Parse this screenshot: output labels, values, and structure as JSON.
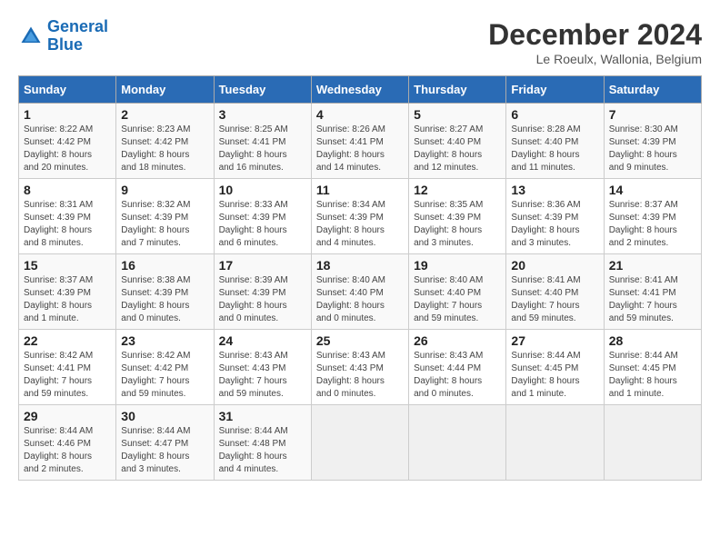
{
  "header": {
    "logo_line1": "General",
    "logo_line2": "Blue",
    "month_title": "December 2024",
    "subtitle": "Le Roeulx, Wallonia, Belgium"
  },
  "columns": [
    "Sunday",
    "Monday",
    "Tuesday",
    "Wednesday",
    "Thursday",
    "Friday",
    "Saturday"
  ],
  "weeks": [
    [
      {
        "day": "1",
        "detail": "Sunrise: 8:22 AM\nSunset: 4:42 PM\nDaylight: 8 hours\nand 20 minutes."
      },
      {
        "day": "2",
        "detail": "Sunrise: 8:23 AM\nSunset: 4:42 PM\nDaylight: 8 hours\nand 18 minutes."
      },
      {
        "day": "3",
        "detail": "Sunrise: 8:25 AM\nSunset: 4:41 PM\nDaylight: 8 hours\nand 16 minutes."
      },
      {
        "day": "4",
        "detail": "Sunrise: 8:26 AM\nSunset: 4:41 PM\nDaylight: 8 hours\nand 14 minutes."
      },
      {
        "day": "5",
        "detail": "Sunrise: 8:27 AM\nSunset: 4:40 PM\nDaylight: 8 hours\nand 12 minutes."
      },
      {
        "day": "6",
        "detail": "Sunrise: 8:28 AM\nSunset: 4:40 PM\nDaylight: 8 hours\nand 11 minutes."
      },
      {
        "day": "7",
        "detail": "Sunrise: 8:30 AM\nSunset: 4:39 PM\nDaylight: 8 hours\nand 9 minutes."
      }
    ],
    [
      {
        "day": "8",
        "detail": "Sunrise: 8:31 AM\nSunset: 4:39 PM\nDaylight: 8 hours\nand 8 minutes."
      },
      {
        "day": "9",
        "detail": "Sunrise: 8:32 AM\nSunset: 4:39 PM\nDaylight: 8 hours\nand 7 minutes."
      },
      {
        "day": "10",
        "detail": "Sunrise: 8:33 AM\nSunset: 4:39 PM\nDaylight: 8 hours\nand 6 minutes."
      },
      {
        "day": "11",
        "detail": "Sunrise: 8:34 AM\nSunset: 4:39 PM\nDaylight: 8 hours\nand 4 minutes."
      },
      {
        "day": "12",
        "detail": "Sunrise: 8:35 AM\nSunset: 4:39 PM\nDaylight: 8 hours\nand 3 minutes."
      },
      {
        "day": "13",
        "detail": "Sunrise: 8:36 AM\nSunset: 4:39 PM\nDaylight: 8 hours\nand 3 minutes."
      },
      {
        "day": "14",
        "detail": "Sunrise: 8:37 AM\nSunset: 4:39 PM\nDaylight: 8 hours\nand 2 minutes."
      }
    ],
    [
      {
        "day": "15",
        "detail": "Sunrise: 8:37 AM\nSunset: 4:39 PM\nDaylight: 8 hours\nand 1 minute."
      },
      {
        "day": "16",
        "detail": "Sunrise: 8:38 AM\nSunset: 4:39 PM\nDaylight: 8 hours\nand 0 minutes."
      },
      {
        "day": "17",
        "detail": "Sunrise: 8:39 AM\nSunset: 4:39 PM\nDaylight: 8 hours\nand 0 minutes."
      },
      {
        "day": "18",
        "detail": "Sunrise: 8:40 AM\nSunset: 4:40 PM\nDaylight: 8 hours\nand 0 minutes."
      },
      {
        "day": "19",
        "detail": "Sunrise: 8:40 AM\nSunset: 4:40 PM\nDaylight: 7 hours\nand 59 minutes."
      },
      {
        "day": "20",
        "detail": "Sunrise: 8:41 AM\nSunset: 4:40 PM\nDaylight: 7 hours\nand 59 minutes."
      },
      {
        "day": "21",
        "detail": "Sunrise: 8:41 AM\nSunset: 4:41 PM\nDaylight: 7 hours\nand 59 minutes."
      }
    ],
    [
      {
        "day": "22",
        "detail": "Sunrise: 8:42 AM\nSunset: 4:41 PM\nDaylight: 7 hours\nand 59 minutes."
      },
      {
        "day": "23",
        "detail": "Sunrise: 8:42 AM\nSunset: 4:42 PM\nDaylight: 7 hours\nand 59 minutes."
      },
      {
        "day": "24",
        "detail": "Sunrise: 8:43 AM\nSunset: 4:43 PM\nDaylight: 7 hours\nand 59 minutes."
      },
      {
        "day": "25",
        "detail": "Sunrise: 8:43 AM\nSunset: 4:43 PM\nDaylight: 8 hours\nand 0 minutes."
      },
      {
        "day": "26",
        "detail": "Sunrise: 8:43 AM\nSunset: 4:44 PM\nDaylight: 8 hours\nand 0 minutes."
      },
      {
        "day": "27",
        "detail": "Sunrise: 8:44 AM\nSunset: 4:45 PM\nDaylight: 8 hours\nand 1 minute."
      },
      {
        "day": "28",
        "detail": "Sunrise: 8:44 AM\nSunset: 4:45 PM\nDaylight: 8 hours\nand 1 minute."
      }
    ],
    [
      {
        "day": "29",
        "detail": "Sunrise: 8:44 AM\nSunset: 4:46 PM\nDaylight: 8 hours\nand 2 minutes."
      },
      {
        "day": "30",
        "detail": "Sunrise: 8:44 AM\nSunset: 4:47 PM\nDaylight: 8 hours\nand 3 minutes."
      },
      {
        "day": "31",
        "detail": "Sunrise: 8:44 AM\nSunset: 4:48 PM\nDaylight: 8 hours\nand 4 minutes."
      },
      {
        "day": "",
        "detail": ""
      },
      {
        "day": "",
        "detail": ""
      },
      {
        "day": "",
        "detail": ""
      },
      {
        "day": "",
        "detail": ""
      }
    ]
  ]
}
